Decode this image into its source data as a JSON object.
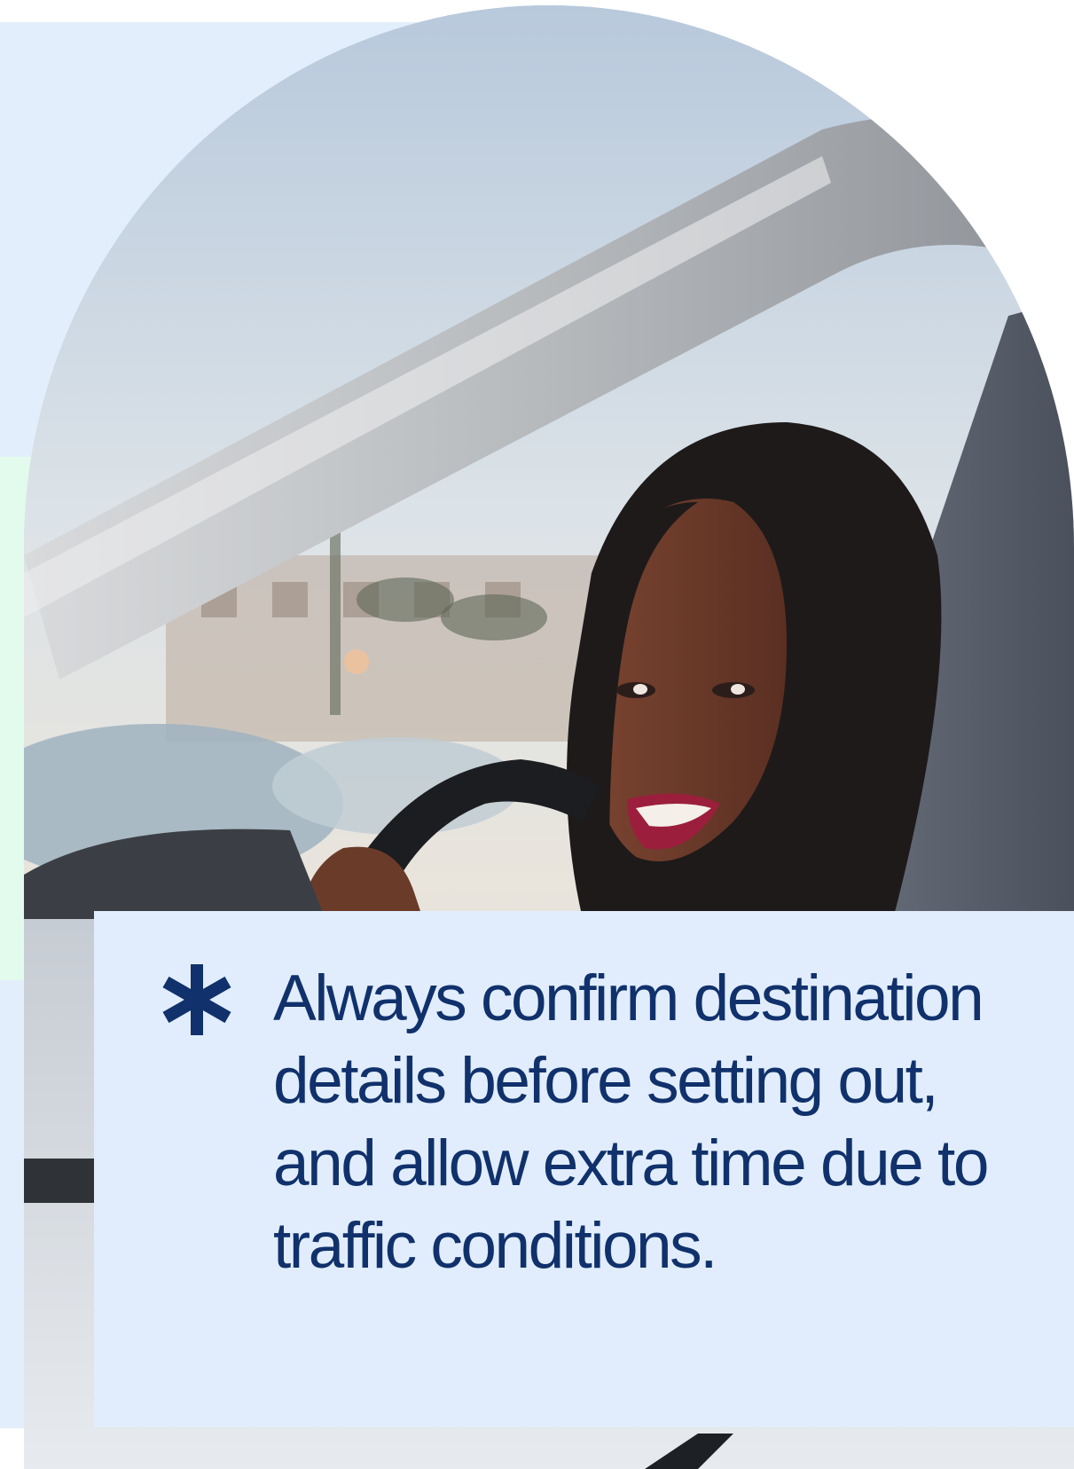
{
  "image": {
    "subject": "woman-smiling-in-car-driver-seat",
    "colors": {
      "background_blue": "#e3eefc",
      "background_mint": "#e2fbec",
      "card_background": "#e1edfc",
      "text_navy": "#10316b",
      "accent_lipstick": "#9b1f3c"
    }
  },
  "callout": {
    "icon": "asterisk-icon",
    "text": "Always confirm destination details before setting out, and allow extra time due to traffic conditions."
  }
}
